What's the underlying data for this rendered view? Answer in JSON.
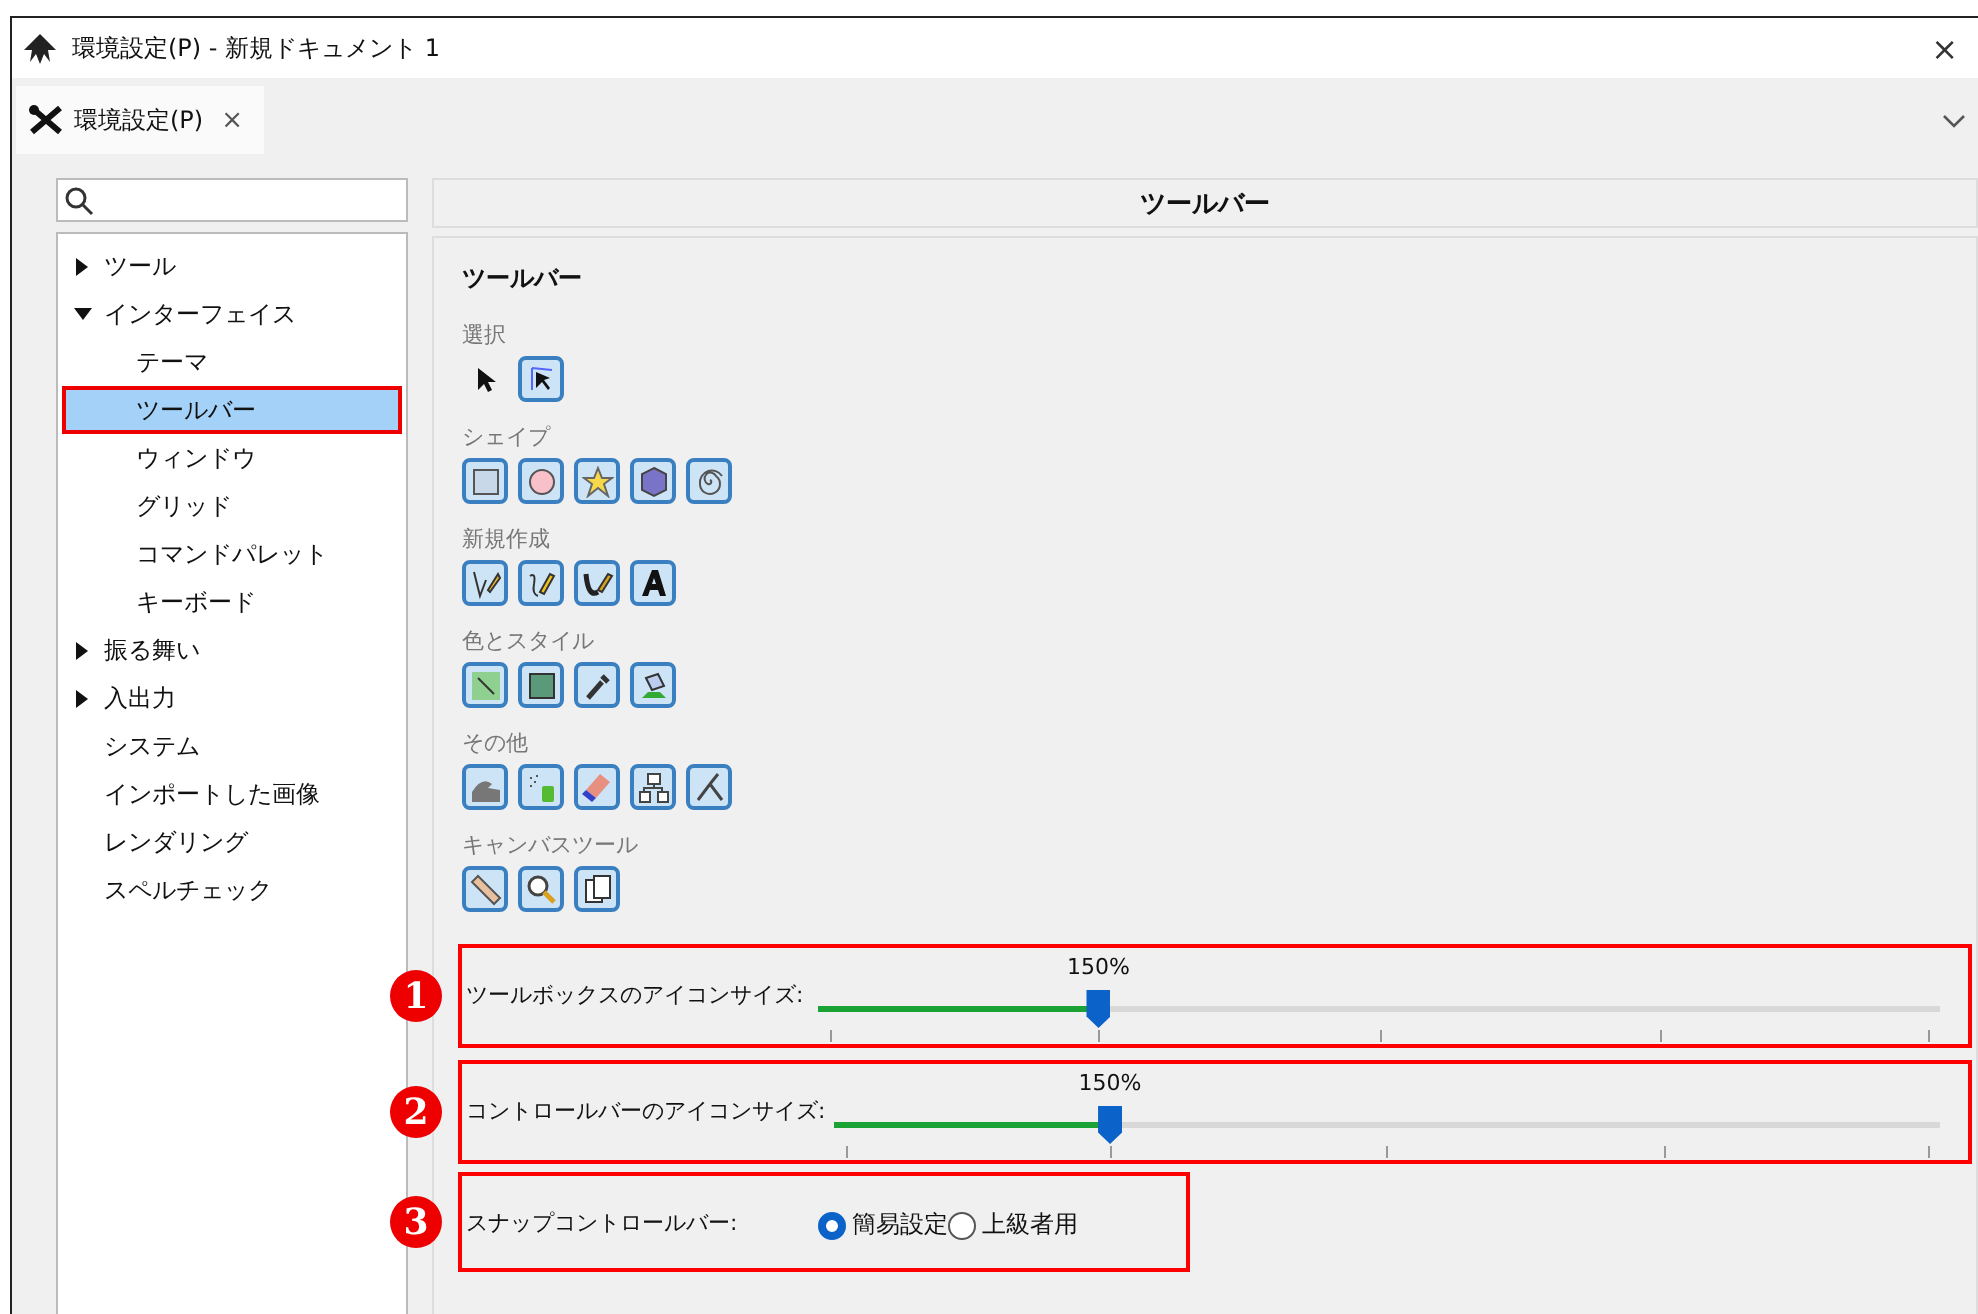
{
  "window": {
    "title": "環境設定(P) - 新規ドキュメント 1",
    "close": "×"
  },
  "tabs": [
    {
      "label": "環境設定(P)",
      "close": "×",
      "selected": true
    }
  ],
  "sidebar": {
    "items": [
      {
        "label": "ツール",
        "expanded": false,
        "selected": false
      },
      {
        "label": "インターフェイス",
        "expanded": true,
        "selected": false,
        "children": [
          {
            "label": "テーマ",
            "selected": false
          },
          {
            "label": "ツールバー",
            "selected": true
          },
          {
            "label": "ウィンドウ",
            "selected": false
          },
          {
            "label": "グリッド",
            "selected": false
          },
          {
            "label": "コマンドパレット",
            "selected": false
          },
          {
            "label": "キーボード",
            "selected": false
          }
        ]
      },
      {
        "label": "振る舞い",
        "expanded": false,
        "selected": false
      },
      {
        "label": "入出力",
        "expanded": false,
        "selected": false
      },
      {
        "label": "システム",
        "selected": false
      },
      {
        "label": "インポートした画像",
        "selected": false
      },
      {
        "label": "レンダリング",
        "selected": false
      },
      {
        "label": "スペルチェック",
        "selected": false
      }
    ]
  },
  "panel": {
    "header": "ツールバー",
    "heading": "ツールバー",
    "groups": [
      {
        "label": "選択",
        "tools": [
          {
            "on": false
          },
          {
            "on": true
          }
        ]
      },
      {
        "label": "シェイプ",
        "tools": [
          {
            "on": true
          },
          {
            "on": true
          },
          {
            "on": true
          },
          {
            "on": true
          },
          {
            "on": true
          }
        ]
      },
      {
        "label": "新規作成",
        "tools": [
          {
            "on": true
          },
          {
            "on": true
          },
          {
            "on": true
          },
          {
            "on": true
          }
        ]
      },
      {
        "label": "色とスタイル",
        "tools": [
          {
            "on": true
          },
          {
            "on": true
          },
          {
            "on": true
          },
          {
            "on": true
          }
        ]
      },
      {
        "label": "その他",
        "tools": [
          {
            "on": true
          },
          {
            "on": true
          },
          {
            "on": true
          },
          {
            "on": true
          },
          {
            "on": true
          }
        ]
      },
      {
        "label": "キャンバスツール",
        "tools": [
          {
            "on": true
          },
          {
            "on": true
          },
          {
            "on": true
          }
        ]
      }
    ],
    "settings": [
      {
        "kind": "slider",
        "number": "1",
        "label": "ツールボックスのアイコンサイズ:",
        "reading": "150%",
        "level": 0.25
      },
      {
        "kind": "slider",
        "number": "2",
        "label": "コントロールバーのアイコンサイズ:",
        "reading": "150%",
        "level": 0.25
      },
      {
        "kind": "radio",
        "number": "3",
        "label": "スナップコントロールバー:",
        "options": [
          {
            "label": "簡易設定",
            "selected": true
          },
          {
            "label": "上級者用",
            "selected": false
          }
        ]
      }
    ]
  }
}
